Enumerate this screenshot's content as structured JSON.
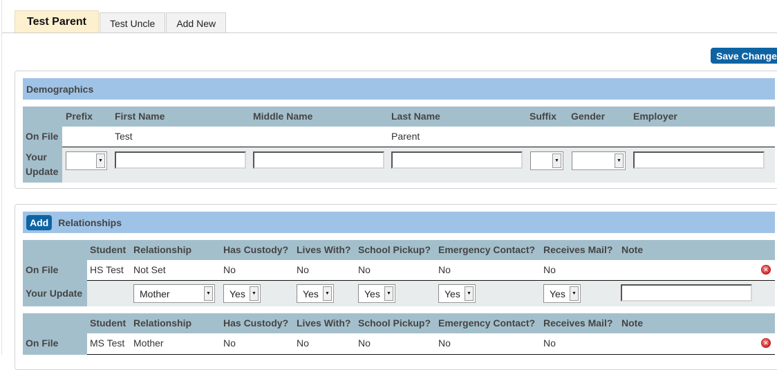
{
  "tabs": [
    {
      "label": "Test Parent",
      "active": true
    },
    {
      "label": "Test Uncle",
      "active": false
    },
    {
      "label": "Add New",
      "active": false
    }
  ],
  "toolbar": {
    "save_label": "Save Changes"
  },
  "demographics": {
    "title": "Demographics",
    "row_labels": {
      "on_file": "On File",
      "your_update_line1": "Your",
      "your_update_line2": "Update"
    },
    "columns": [
      "Prefix",
      "First Name",
      "Middle Name",
      "Last Name",
      "Suffix",
      "Gender",
      "Employer"
    ],
    "on_file": {
      "prefix": "",
      "first_name": "Test",
      "middle_name": "",
      "last_name": "Parent",
      "suffix": "",
      "gender": "",
      "employer": ""
    },
    "update": {
      "prefix": "",
      "first_name": "",
      "middle_name": "",
      "last_name": "",
      "suffix": "",
      "gender": "",
      "employer": ""
    }
  },
  "relationships": {
    "add_label": "Add",
    "title": "Relationships",
    "row_labels": {
      "on_file": "On File",
      "your_update": "Your Update"
    },
    "columns": [
      "Student",
      "Relationship",
      "Has Custody?",
      "Lives With?",
      "School Pickup?",
      "Emergency Contact?",
      "Receives Mail?",
      "Note"
    ],
    "records": [
      {
        "on_file": {
          "student": "HS Test",
          "relationship": "Not Set",
          "has_custody": "No",
          "lives_with": "No",
          "school_pickup": "No",
          "emergency_contact": "No",
          "receives_mail": "No",
          "note": ""
        },
        "update": {
          "relationship": "Mother",
          "has_custody": "Yes",
          "lives_with": "Yes",
          "school_pickup": "Yes",
          "emergency_contact": "Yes",
          "receives_mail": "Yes",
          "note": ""
        }
      },
      {
        "on_file": {
          "student": "MS Test",
          "relationship": "Mother",
          "has_custody": "No",
          "lives_with": "No",
          "school_pickup": "No",
          "emergency_contact": "No",
          "receives_mail": "No",
          "note": ""
        }
      }
    ]
  },
  "icons": {
    "delete": "delete-circle-icon",
    "dropdown": "chevron-down-icon"
  }
}
